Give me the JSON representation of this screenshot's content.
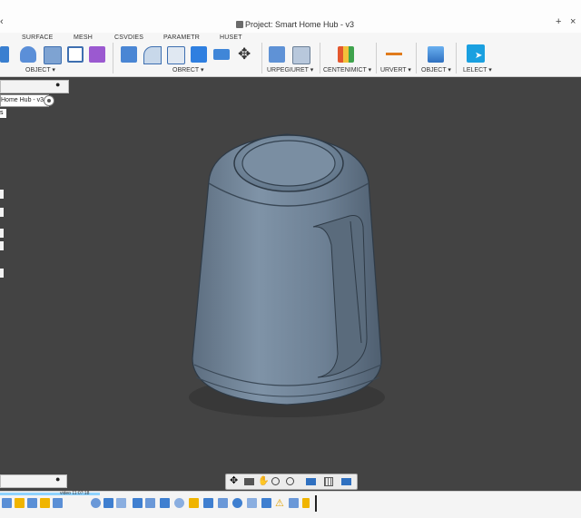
{
  "window": {
    "title": "Project: Smart Home Hub - v3",
    "controls": [
      "−",
      "□"
    ]
  },
  "ribbon": {
    "tabs": [
      "SURFACE",
      "MESH",
      "CSVDIES",
      "PARAMETR",
      "HUSET"
    ],
    "groups": [
      "OBJECT ▾",
      "OBRECT ▾",
      "URPEGIURET ▾",
      "CENTENIMICT ▾",
      "URVERT ▾",
      "OBJECT ▾",
      "LELECT ▾"
    ]
  },
  "browser": {
    "document_label": "Home Hub - v3",
    "item_label": "s"
  },
  "timeline": {
    "time_text": "video 11:07:18"
  },
  "colors": {
    "viewport_bg": "#434343",
    "model_body": "#6f8193",
    "accent_select": "#1aa0e0",
    "warning": "#f0b400"
  },
  "icons": {
    "navbar": [
      "orbit-icon",
      "look-at-icon",
      "pan-hand-icon",
      "zoom-icon",
      "zoom-window-icon",
      "display-mode-icon",
      "grid-icon",
      "viewports-icon"
    ],
    "timeline": [
      "play-start-icon",
      "step-back-icon",
      "play-icon",
      "step-forward-icon",
      "play-end-icon"
    ]
  }
}
